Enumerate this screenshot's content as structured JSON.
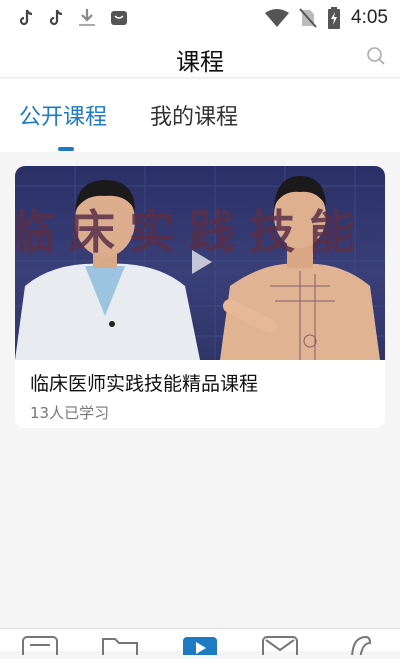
{
  "status_bar": {
    "time": "4:05",
    "left_icons": [
      "tiktok-icon",
      "tiktok-icon",
      "download-icon",
      "app-notification-icon"
    ],
    "right_icons": [
      "wifi-icon",
      "no-sim-icon",
      "battery-charging-icon"
    ]
  },
  "header": {
    "title": "课程",
    "search_icon": "search-icon"
  },
  "tabs": [
    {
      "label": "公开课程",
      "active": true
    },
    {
      "label": "我的课程",
      "active": false
    }
  ],
  "courses": [
    {
      "thumbnail_banner_text": "临床实践技能",
      "title": "临床医师实践技能精品课程",
      "learners": "13人已学习"
    }
  ],
  "bottom_nav": {
    "items": [
      "home-list-icon",
      "folder-icon",
      "play-icon",
      "message-icon",
      "profile-icon"
    ],
    "active_index": 2
  },
  "colors": {
    "accent": "#1d7bc4",
    "background": "#f5f5f5",
    "card": "#ffffff",
    "thumb_bg": "#2f3568"
  }
}
